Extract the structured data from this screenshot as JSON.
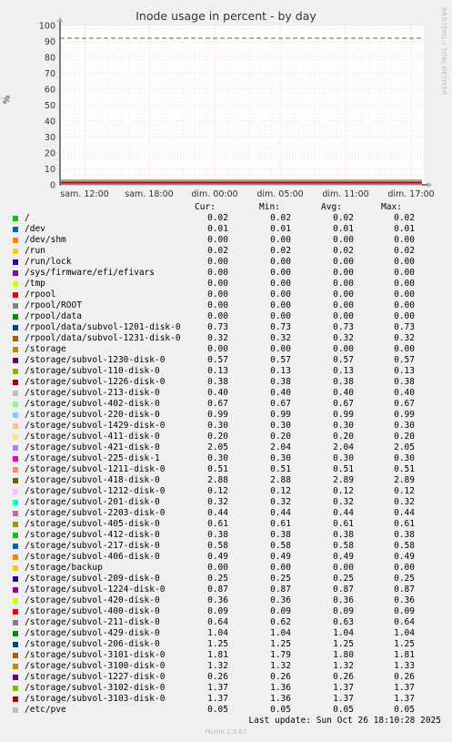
{
  "chart_data": {
    "type": "line",
    "title": "Inode usage in percent - by day",
    "ylabel": "%",
    "ylim": [
      0,
      100
    ],
    "yticks": [
      "0",
      "10",
      "20",
      "30",
      "40",
      "50",
      "60",
      "70",
      "80",
      "90",
      "100"
    ],
    "xticks": [
      "sam. 12:00",
      "sam. 18:00",
      "dim. 00:00",
      "dim. 05:00",
      "dim. 11:00",
      "dim. 17:00"
    ],
    "grid": true,
    "warning_line": 92
  },
  "side_credit": "RRDTOOL / TOBI OETIKER",
  "legend": {
    "headers": {
      "cur": "Cur:",
      "min": "Min:",
      "avg": "Avg:",
      "max": "Max:"
    },
    "rows": [
      {
        "name": "/",
        "color": "#00cc00",
        "cur": "0.02",
        "min": "0.02",
        "avg": "0.02",
        "max": "0.02"
      },
      {
        "name": "/dev",
        "color": "#0066b3",
        "cur": "0.01",
        "min": "0.01",
        "avg": "0.01",
        "max": "0.01"
      },
      {
        "name": "/dev/shm",
        "color": "#ff8000",
        "cur": "0.00",
        "min": "0.00",
        "avg": "0.00",
        "max": "0.00"
      },
      {
        "name": "/run",
        "color": "#ffcc00",
        "cur": "0.02",
        "min": "0.02",
        "avg": "0.02",
        "max": "0.02"
      },
      {
        "name": "/run/lock",
        "color": "#330099",
        "cur": "0.00",
        "min": "0.00",
        "avg": "0.00",
        "max": "0.00"
      },
      {
        "name": "/sys/firmware/efi/efivars",
        "color": "#990099",
        "cur": "0.00",
        "min": "0.00",
        "avg": "0.00",
        "max": "0.00"
      },
      {
        "name": "/tmp",
        "color": "#ccff00",
        "cur": "0.00",
        "min": "0.00",
        "avg": "0.00",
        "max": "0.00"
      },
      {
        "name": "/rpool",
        "color": "#ff0000",
        "cur": "0.00",
        "min": "0.00",
        "avg": "0.00",
        "max": "0.00"
      },
      {
        "name": "/rpool/ROOT",
        "color": "#808080",
        "cur": "0.00",
        "min": "0.00",
        "avg": "0.00",
        "max": "0.00"
      },
      {
        "name": "/rpool/data",
        "color": "#008f00",
        "cur": "0.00",
        "min": "0.00",
        "avg": "0.00",
        "max": "0.00"
      },
      {
        "name": "/rpool/data/subvol-1201-disk-0",
        "color": "#00487d",
        "cur": "0.73",
        "min": "0.73",
        "avg": "0.73",
        "max": "0.73"
      },
      {
        "name": "/rpool/data/subvol-1231-disk-0",
        "color": "#b35a00",
        "cur": "0.32",
        "min": "0.32",
        "avg": "0.32",
        "max": "0.32"
      },
      {
        "name": "/storage",
        "color": "#b38f00",
        "cur": "0.00",
        "min": "0.00",
        "avg": "0.00",
        "max": "0.00"
      },
      {
        "name": "/storage/subvol-1230-disk-0",
        "color": "#6b006b",
        "cur": "0.57",
        "min": "0.57",
        "avg": "0.57",
        "max": "0.57"
      },
      {
        "name": "/storage/subvol-110-disk-0",
        "color": "#8fb300",
        "cur": "0.13",
        "min": "0.13",
        "avg": "0.13",
        "max": "0.13"
      },
      {
        "name": "/storage/subvol-1226-disk-0",
        "color": "#b30000",
        "cur": "0.38",
        "min": "0.38",
        "avg": "0.38",
        "max": "0.38"
      },
      {
        "name": "/storage/subvol-213-disk-0",
        "color": "#bebebe",
        "cur": "0.40",
        "min": "0.40",
        "avg": "0.40",
        "max": "0.40"
      },
      {
        "name": "/storage/subvol-402-disk-0",
        "color": "#80ff80",
        "cur": "0.67",
        "min": "0.67",
        "avg": "0.67",
        "max": "0.67"
      },
      {
        "name": "/storage/subvol-220-disk-0",
        "color": "#80c9ff",
        "cur": "0.99",
        "min": "0.99",
        "avg": "0.99",
        "max": "0.99"
      },
      {
        "name": "/storage/subvol-1429-disk-0",
        "color": "#ffc080",
        "cur": "0.30",
        "min": "0.30",
        "avg": "0.30",
        "max": "0.30"
      },
      {
        "name": "/storage/subvol-411-disk-0",
        "color": "#ffe680",
        "cur": "0.20",
        "min": "0.20",
        "avg": "0.20",
        "max": "0.20"
      },
      {
        "name": "/storage/subvol-421-disk-0",
        "color": "#aa80ff",
        "cur": "2.05",
        "min": "2.04",
        "avg": "2.04",
        "max": "2.05"
      },
      {
        "name": "/storage/subvol-225-disk-1",
        "color": "#ee00cc",
        "cur": "0.30",
        "min": "0.30",
        "avg": "0.30",
        "max": "0.30"
      },
      {
        "name": "/storage/subvol-1211-disk-0",
        "color": "#ff8080",
        "cur": "0.51",
        "min": "0.51",
        "avg": "0.51",
        "max": "0.51"
      },
      {
        "name": "/storage/subvol-418-disk-0",
        "color": "#666600",
        "cur": "2.88",
        "min": "2.88",
        "avg": "2.89",
        "max": "2.89"
      },
      {
        "name": "/storage/subvol-1212-disk-0",
        "color": "#ffbfff",
        "cur": "0.12",
        "min": "0.12",
        "avg": "0.12",
        "max": "0.12"
      },
      {
        "name": "/storage/subvol-201-disk-0",
        "color": "#00ffcc",
        "cur": "0.32",
        "min": "0.32",
        "avg": "0.32",
        "max": "0.32"
      },
      {
        "name": "/storage/subvol-2203-disk-0",
        "color": "#cc6699",
        "cur": "0.44",
        "min": "0.44",
        "avg": "0.44",
        "max": "0.44"
      },
      {
        "name": "/storage/subvol-405-disk-0",
        "color": "#999900",
        "cur": "0.61",
        "min": "0.61",
        "avg": "0.61",
        "max": "0.61"
      },
      {
        "name": "/storage/subvol-412-disk-0",
        "color": "#00cc00",
        "cur": "0.38",
        "min": "0.38",
        "avg": "0.38",
        "max": "0.38"
      },
      {
        "name": "/storage/subvol-217-disk-0",
        "color": "#0066b3",
        "cur": "0.58",
        "min": "0.58",
        "avg": "0.58",
        "max": "0.58"
      },
      {
        "name": "/storage/subvol-406-disk-0",
        "color": "#ff8000",
        "cur": "0.49",
        "min": "0.49",
        "avg": "0.49",
        "max": "0.49"
      },
      {
        "name": "/storage/backup",
        "color": "#ffcc00",
        "cur": "0.00",
        "min": "0.00",
        "avg": "0.00",
        "max": "0.00"
      },
      {
        "name": "/storage/subvol-209-disk-0",
        "color": "#330099",
        "cur": "0.25",
        "min": "0.25",
        "avg": "0.25",
        "max": "0.25"
      },
      {
        "name": "/storage/subvol-1224-disk-0",
        "color": "#990099",
        "cur": "0.87",
        "min": "0.87",
        "avg": "0.87",
        "max": "0.87"
      },
      {
        "name": "/storage/subvol-420-disk-0",
        "color": "#ccff00",
        "cur": "0.36",
        "min": "0.36",
        "avg": "0.36",
        "max": "0.36"
      },
      {
        "name": "/storage/subvol-400-disk-0",
        "color": "#ff0000",
        "cur": "0.09",
        "min": "0.09",
        "avg": "0.09",
        "max": "0.09"
      },
      {
        "name": "/storage/subvol-211-disk-0",
        "color": "#808080",
        "cur": "0.64",
        "min": "0.62",
        "avg": "0.63",
        "max": "0.64"
      },
      {
        "name": "/storage/subvol-429-disk-0",
        "color": "#008f00",
        "cur": "1.04",
        "min": "1.04",
        "avg": "1.04",
        "max": "1.04"
      },
      {
        "name": "/storage/subvol-206-disk-0",
        "color": "#00487d",
        "cur": "1.25",
        "min": "1.25",
        "avg": "1.25",
        "max": "1.25"
      },
      {
        "name": "/storage/subvol-3101-disk-0",
        "color": "#b35a00",
        "cur": "1.81",
        "min": "1.79",
        "avg": "1.80",
        "max": "1.81"
      },
      {
        "name": "/storage/subvol-3100-disk-0",
        "color": "#b38f00",
        "cur": "1.32",
        "min": "1.32",
        "avg": "1.32",
        "max": "1.33"
      },
      {
        "name": "/storage/subvol-1227-disk-0",
        "color": "#6b006b",
        "cur": "0.26",
        "min": "0.26",
        "avg": "0.26",
        "max": "0.26"
      },
      {
        "name": "/storage/subvol-3102-disk-0",
        "color": "#8fb300",
        "cur": "1.37",
        "min": "1.36",
        "avg": "1.37",
        "max": "1.37"
      },
      {
        "name": "/storage/subvol-3103-disk-0",
        "color": "#b30000",
        "cur": "1.37",
        "min": "1.36",
        "avg": "1.37",
        "max": "1.37"
      },
      {
        "name": "/etc/pve",
        "color": "#bebebe",
        "cur": "0.05",
        "min": "0.05",
        "avg": "0.05",
        "max": "0.05"
      }
    ]
  },
  "footer": {
    "last_update": "Last update: Sun Oct 26 18:10:28 2025",
    "munin": "Munin 2.0.67"
  }
}
